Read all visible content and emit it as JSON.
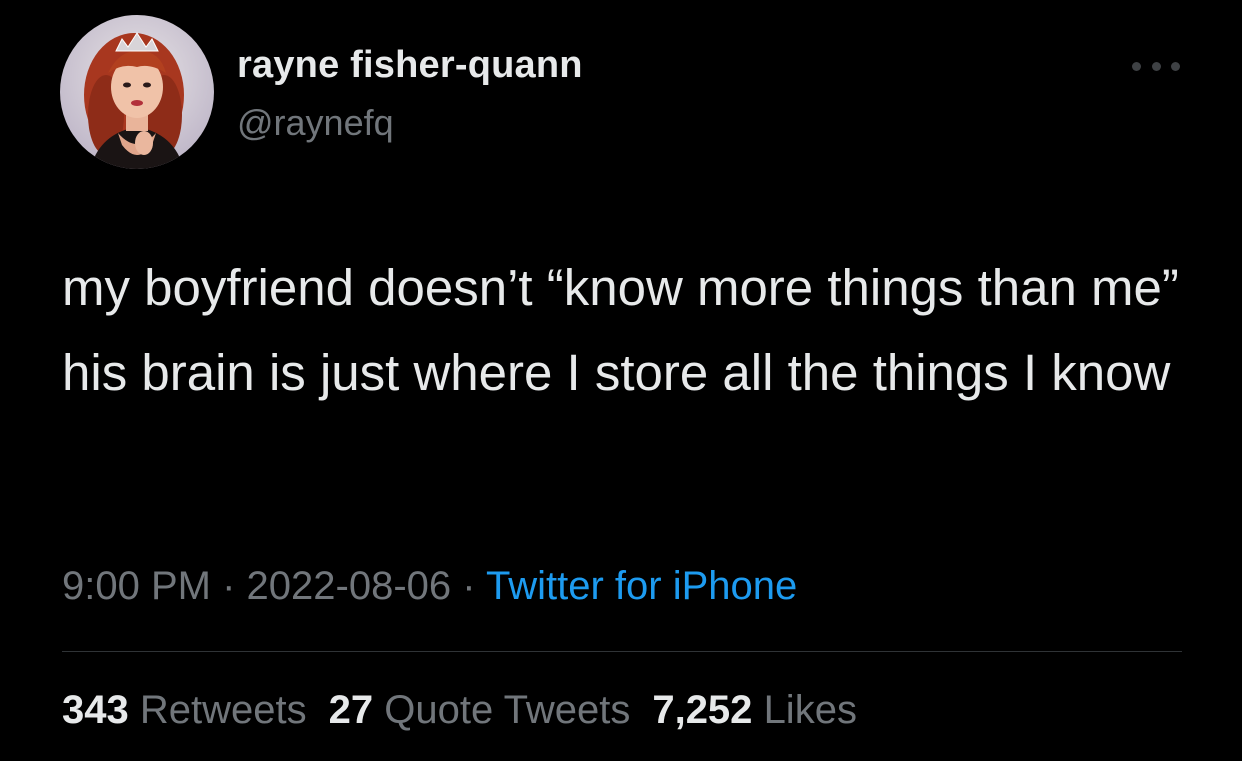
{
  "author": {
    "display_name": "rayne fisher-quann",
    "handle": "@raynefq",
    "avatar_icon": "profile-photo"
  },
  "tweet": {
    "text": "my boyfriend doesn’t “know more things than me” his brain is just where I store all the things I know",
    "time": "9:00 PM",
    "date": "2022-08-06",
    "separator": "·",
    "source": "Twitter for iPhone"
  },
  "stats": {
    "retweets_count": "343",
    "retweets_label": "Retweets",
    "quotes_count": "27",
    "quotes_label": "Quote Tweets",
    "likes_count": "7,252",
    "likes_label": "Likes"
  },
  "colors": {
    "background": "#000000",
    "primary_text": "#e7e9ea",
    "secondary_text": "#71767b",
    "link": "#1d9bf0",
    "divider": "#2f3336"
  },
  "more_icon": "more-horizontal-icon"
}
